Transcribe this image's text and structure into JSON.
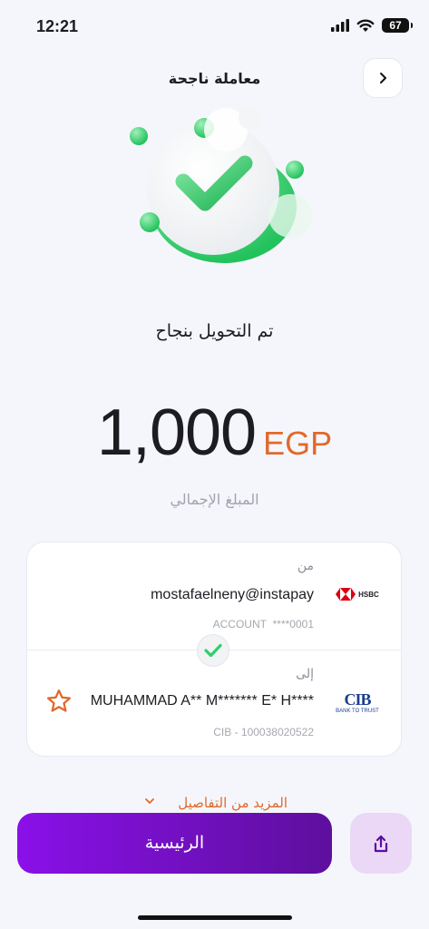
{
  "status_bar": {
    "time": "12:21",
    "battery": "67"
  },
  "header": {
    "title": "معاملة ناجحة"
  },
  "hero": {
    "message": "تم التحويل بنجاح"
  },
  "amount": {
    "value": "1,000",
    "currency": "EGP",
    "label": "المبلغ الإجمالي"
  },
  "from": {
    "label": "من",
    "name": "mostafaelneny@instapay",
    "account_label": "ACCOUNT",
    "account_number": "****0001",
    "bank_logo_text": "HSBC"
  },
  "to": {
    "label": "إلى",
    "name": "MUHAMMAD A** M******* E* H****",
    "account": "CIB - 100038020522",
    "bank_logo_text": "CIB",
    "bank_tagline": "BANK TO TRUST"
  },
  "more_details": "المزيد من التفاصيل",
  "home_button": "الرئيسية",
  "colors": {
    "accent": "#e0692c",
    "primary": "#7a12d2",
    "success": "#2fcf6a"
  }
}
